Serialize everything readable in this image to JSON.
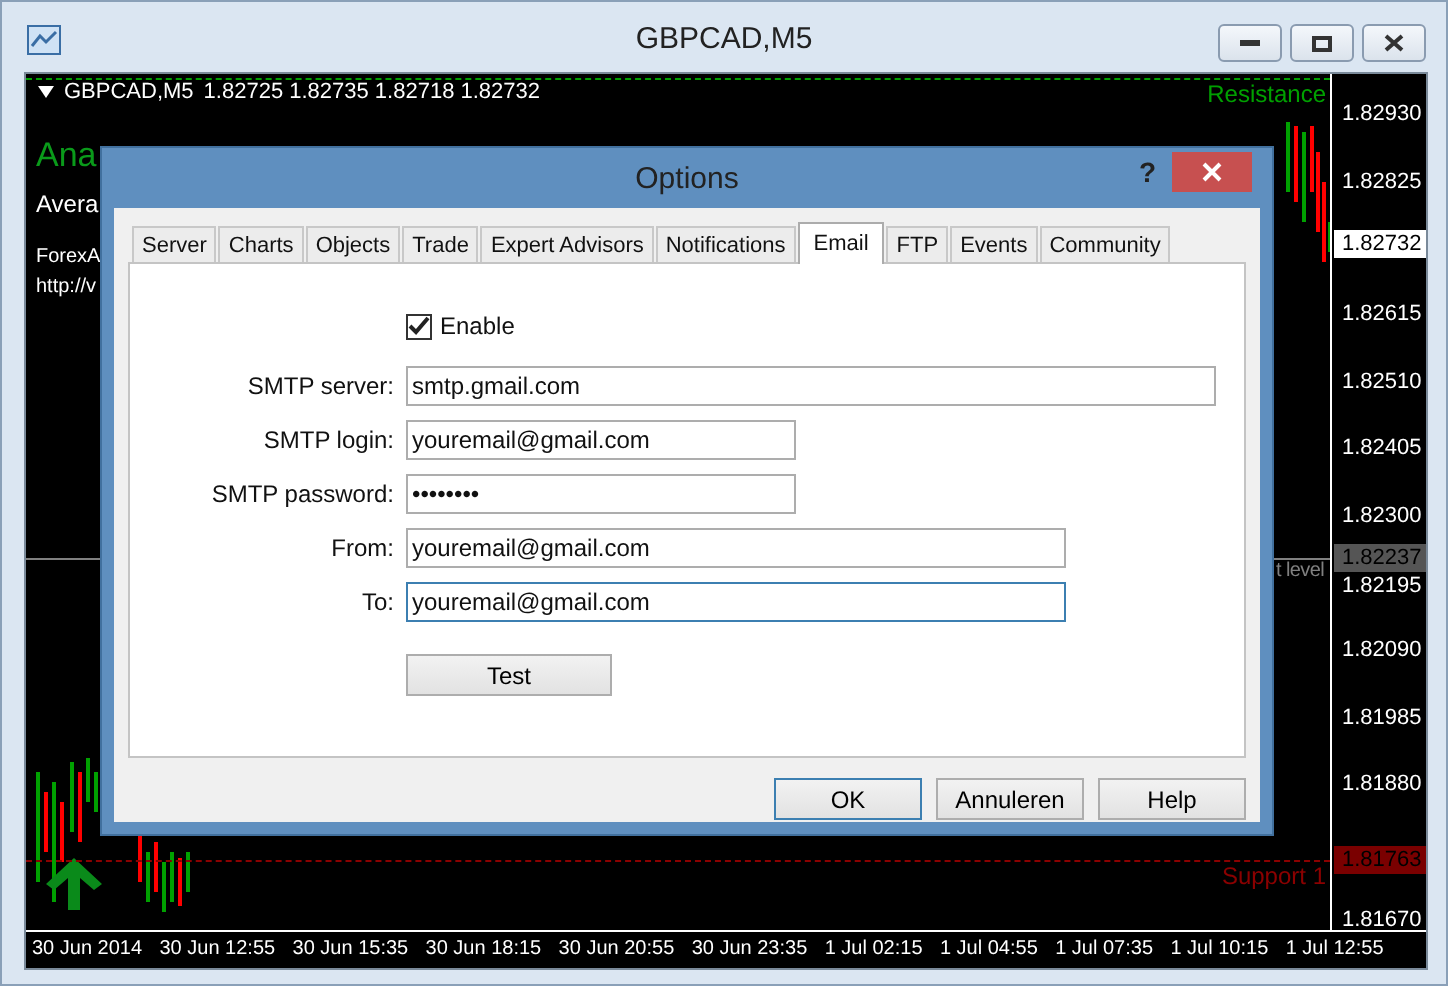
{
  "window": {
    "title": "GBPCAD,M5"
  },
  "chart": {
    "symbol": "GBPCAD,M5",
    "quote": "1.82725 1.82735 1.82718 1.82732",
    "overlay_texts": [
      {
        "text": "Ana",
        "kind": "title"
      },
      {
        "text": "Avera",
        "kind": "subtitle"
      },
      {
        "text": "ForexA",
        "kind": "note"
      },
      {
        "text": "http://v",
        "kind": "note"
      }
    ],
    "price_ticks": [
      "1.82930",
      "1.82825",
      "1.82615",
      "1.82510",
      "1.82405",
      "1.82300",
      "1.82195",
      "1.82090",
      "1.81985",
      "1.81880",
      "1.81670"
    ],
    "price_labels": [
      {
        "text": "1.82732",
        "kind": "current"
      },
      {
        "text": "1.82237",
        "kind": "level"
      },
      {
        "text": "1.81763",
        "kind": "support"
      }
    ],
    "lines": [
      {
        "label": "Resistance",
        "kind": "resistance",
        "color": "#00a000"
      },
      {
        "label": "t level",
        "kind": "level",
        "color": "#808080"
      },
      {
        "label": "Support 1",
        "kind": "support",
        "color": "#8b0000"
      }
    ],
    "time_ticks": [
      "30 Jun 2014",
      "30 Jun 12:55",
      "30 Jun 15:35",
      "30 Jun 18:15",
      "30 Jun 20:55",
      "30 Jun 23:35",
      "1 Jul 02:15",
      "1 Jul 04:55",
      "1 Jul 07:35",
      "1 Jul 10:15",
      "1 Jul 12:55"
    ]
  },
  "dialog": {
    "title": "Options",
    "help": "?",
    "tabs": [
      {
        "label": "Server",
        "selected": false
      },
      {
        "label": "Charts",
        "selected": false
      },
      {
        "label": "Objects",
        "selected": false
      },
      {
        "label": "Trade",
        "selected": false
      },
      {
        "label": "Expert Advisors",
        "selected": false
      },
      {
        "label": "Notifications",
        "selected": false
      },
      {
        "label": "Email",
        "selected": true
      },
      {
        "label": "FTP",
        "selected": false
      },
      {
        "label": "Events",
        "selected": false
      },
      {
        "label": "Community",
        "selected": false
      }
    ],
    "enable": {
      "label": "Enable",
      "checked": true
    },
    "fields": [
      {
        "label": "SMTP server:",
        "value": "smtp.gmail.com",
        "kind": "wide",
        "focused": false
      },
      {
        "label": "SMTP login:",
        "value": "youremail@gmail.com",
        "kind": "short",
        "focused": false
      },
      {
        "label": "SMTP password:",
        "value": "••••••••",
        "kind": "short",
        "focused": false
      },
      {
        "label": "From:",
        "value": "youremail@gmail.com",
        "kind": "medium",
        "focused": false
      },
      {
        "label": "To:",
        "value": "youremail@gmail.com",
        "kind": "medium",
        "focused": true
      }
    ],
    "test_button": "Test",
    "buttons": [
      {
        "label": "OK",
        "kind": "default"
      },
      {
        "label": "Annuleren",
        "kind": "normal"
      },
      {
        "label": "Help",
        "kind": "normal"
      }
    ]
  }
}
